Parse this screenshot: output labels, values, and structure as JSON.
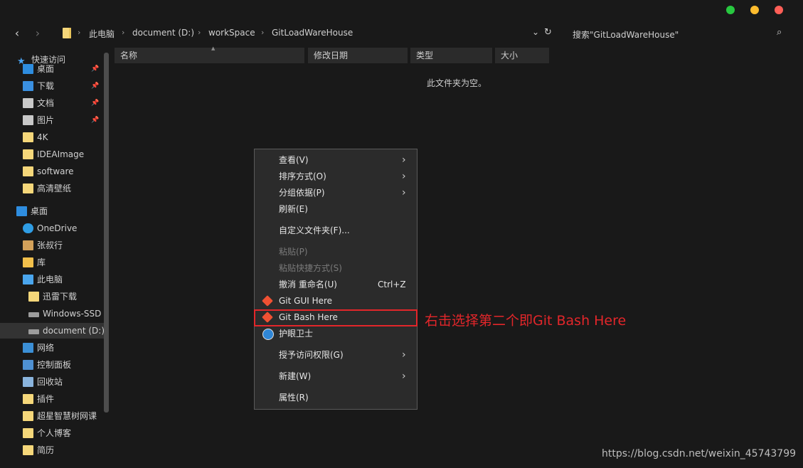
{
  "window": {
    "controls": [
      {
        "name": "minimize",
        "color": "#28c840"
      },
      {
        "name": "maximize",
        "color": "#febc2e"
      },
      {
        "name": "close",
        "color": "#ff5f57"
      }
    ]
  },
  "address": {
    "crumbs": [
      "此电脑",
      "document (D:)",
      "workSpace",
      "GitLoadWareHouse"
    ],
    "search_placeholder": "搜索\"GitLoadWareHouse\""
  },
  "columns": [
    "名称",
    "修改日期",
    "类型",
    "大小"
  ],
  "empty_message": "此文件夹为空。",
  "sidebar": {
    "quick_access_label": "快速访问",
    "items": [
      {
        "label": "桌面",
        "icon": "desktop-icon",
        "pinned": true
      },
      {
        "label": "下载",
        "icon": "download-icon",
        "pinned": true
      },
      {
        "label": "文档",
        "icon": "document-icon",
        "pinned": true
      },
      {
        "label": "图片",
        "icon": "picture-icon",
        "pinned": true
      },
      {
        "label": "4K",
        "icon": "folder-icon"
      },
      {
        "label": "IDEAImage",
        "icon": "folder-icon"
      },
      {
        "label": "software",
        "icon": "folder-icon"
      },
      {
        "label": "高清壁纸",
        "icon": "folder-icon"
      },
      {
        "label": "桌面",
        "icon": "desktop-icon"
      },
      {
        "label": "OneDrive",
        "icon": "cloud-icon"
      },
      {
        "label": "张叔行",
        "icon": "user-icon"
      },
      {
        "label": "库",
        "icon": "library-icon"
      },
      {
        "label": "此电脑",
        "icon": "computer-icon"
      },
      {
        "label": "迅雷下载",
        "icon": "folder-icon"
      },
      {
        "label": "Windows-SSD",
        "icon": "drive-icon"
      },
      {
        "label": "document (D:)",
        "icon": "drive-icon",
        "selected": true
      },
      {
        "label": "网络",
        "icon": "network-icon"
      },
      {
        "label": "控制面板",
        "icon": "control-panel-icon"
      },
      {
        "label": "回收站",
        "icon": "recycle-bin-icon"
      },
      {
        "label": "插件",
        "icon": "folder-icon"
      },
      {
        "label": "超星智慧树网课",
        "icon": "folder-icon"
      },
      {
        "label": "个人博客",
        "icon": "folder-icon"
      },
      {
        "label": "简历",
        "icon": "folder-icon"
      }
    ]
  },
  "context_menu": {
    "items": [
      {
        "label": "查看(V)",
        "submenu": true
      },
      {
        "label": "排序方式(O)",
        "submenu": true
      },
      {
        "label": "分组依据(P)",
        "submenu": true
      },
      {
        "label": "刷新(E)"
      },
      {
        "label": "自定义文件夹(F)..."
      },
      {
        "label": "粘贴(P)",
        "disabled": true
      },
      {
        "label": "粘贴快捷方式(S)",
        "disabled": true
      },
      {
        "label": "撤消 重命名(U)",
        "shortcut": "Ctrl+Z"
      },
      {
        "label": "Git GUI Here",
        "icon": "git-icon"
      },
      {
        "label": "Git Bash Here",
        "icon": "git-icon"
      },
      {
        "label": "护眼卫士",
        "icon": "clock-icon"
      },
      {
        "label": "授予访问权限(G)",
        "submenu": true
      },
      {
        "label": "新建(W)",
        "submenu": true
      },
      {
        "label": "属性(R)"
      }
    ]
  },
  "annotation": {
    "text": "右击选择第二个即Git Bash Here",
    "color": "#e3262a"
  },
  "watermark": "https://blog.csdn.net/weixin_45743799"
}
